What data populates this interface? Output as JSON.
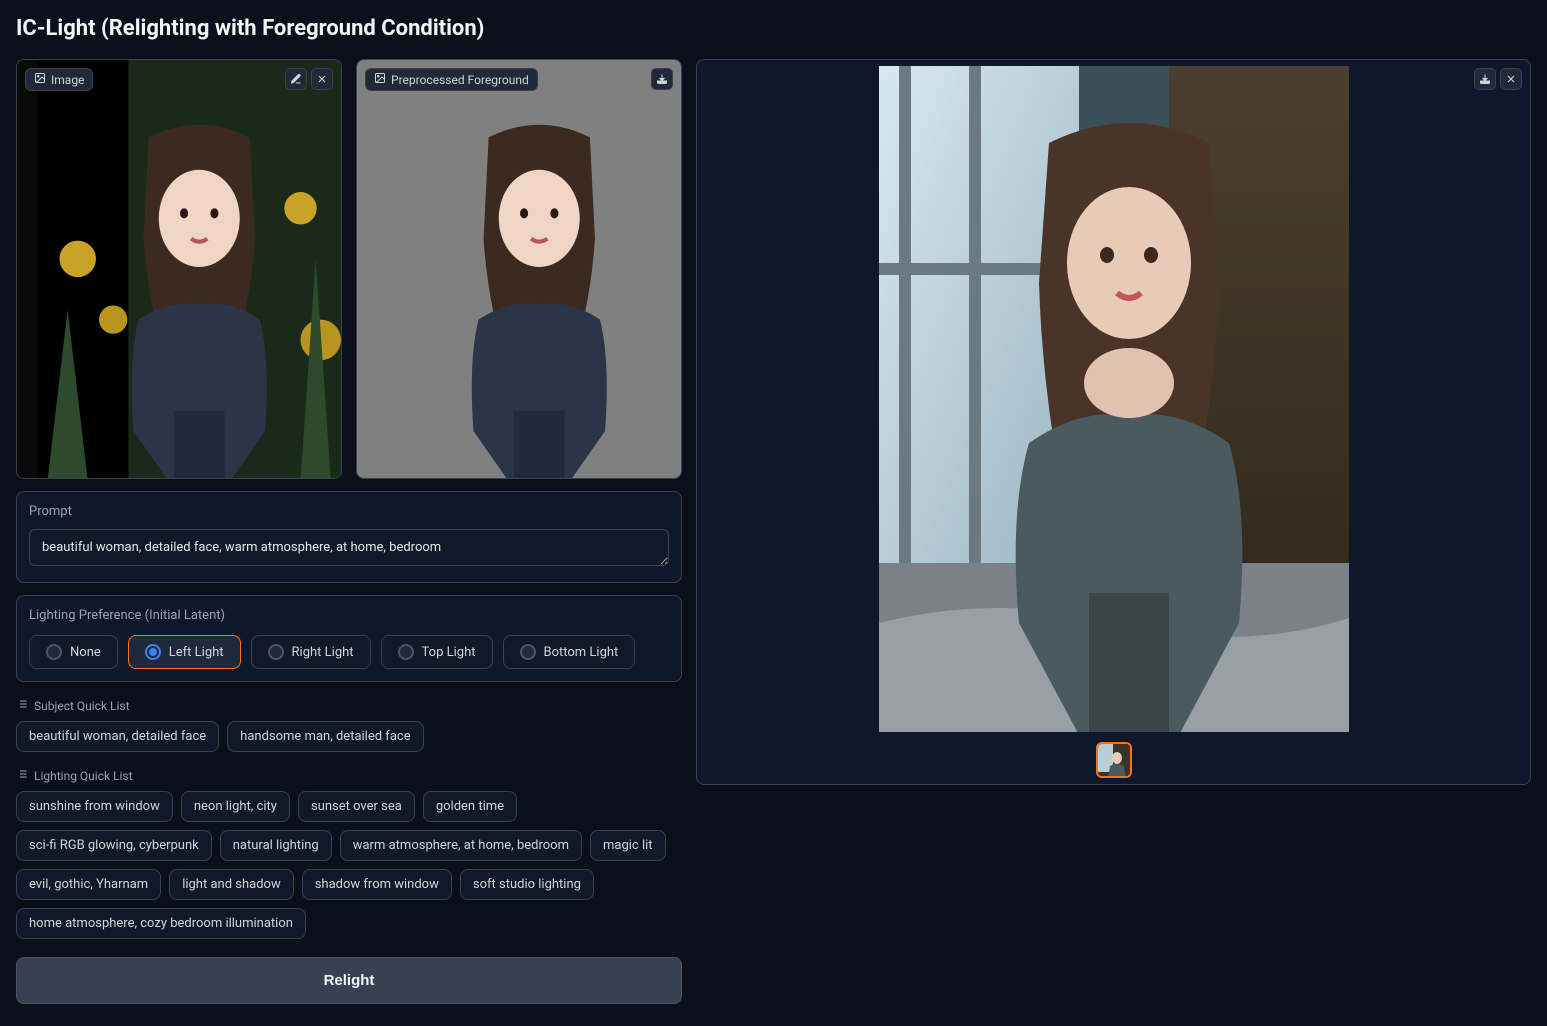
{
  "title": "IC-Light (Relighting with Foreground Condition)",
  "panels": {
    "image_label": "Image",
    "preprocessed_label": "Preprocessed Foreground"
  },
  "prompt": {
    "label": "Prompt",
    "value": "beautiful woman, detailed face, warm atmosphere, at home, bedroom"
  },
  "lighting": {
    "label": "Lighting Preference (Initial Latent)",
    "options": [
      "None",
      "Left Light",
      "Right Light",
      "Top Light",
      "Bottom Light"
    ],
    "selected": "Left Light"
  },
  "subject_quick": {
    "label": "Subject Quick List",
    "items": [
      "beautiful woman, detailed face",
      "handsome man, detailed face"
    ]
  },
  "lighting_quick": {
    "label": "Lighting Quick List",
    "items": [
      "sunshine from window",
      "neon light, city",
      "sunset over sea",
      "golden time",
      "sci-fi RGB glowing, cyberpunk",
      "natural lighting",
      "warm atmosphere, at home, bedroom",
      "magic lit",
      "evil, gothic, Yharnam",
      "light and shadow",
      "shadow from window",
      "soft studio lighting",
      "home atmosphere, cozy bedroom illumination"
    ]
  },
  "relight_button": "Relight"
}
